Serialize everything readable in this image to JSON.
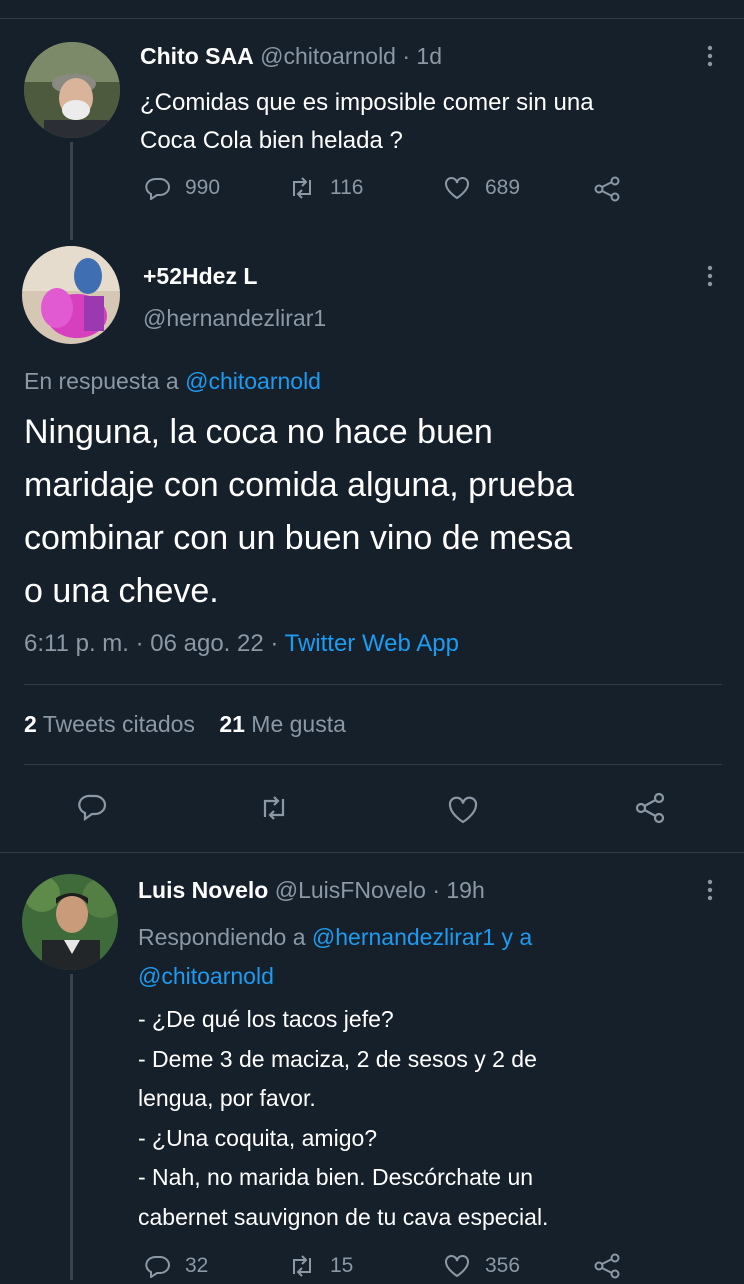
{
  "tweet1": {
    "name": "Chito SAA",
    "handle": "@chitoarnold",
    "time": "· 1d",
    "text_line1": "¿Comidas que es imposible comer sin una",
    "text_line2": "Coca Cola bien helada ?",
    "replies": "990",
    "retweets": "116",
    "likes": "689"
  },
  "tweet2": {
    "name": "+52Hdez L",
    "handle": "@hernandezlirar1",
    "reply_prefix": "En respuesta a ",
    "reply_to": "@chitoarnold",
    "text_lines": [
      "Ninguna, la coca no hace buen",
      "maridaje con comida alguna, prueba",
      "combinar con un buen vino de mesa",
      "o una cheve."
    ],
    "time": "6:11 p. m. · 06 ago. 22 · ",
    "source": "Twitter Web App",
    "quotes_count": "2",
    "quotes_label": "Tweets citados",
    "likes_count": "21",
    "likes_label": "Me gusta"
  },
  "tweet3": {
    "name": "Luis Novelo",
    "handle": "@LuisFNovelo",
    "time": "· 19h",
    "reply_prefix": "Respondiendo a ",
    "reply_to1": "@hernandezlirar1",
    "reply_and": " y a",
    "reply_to2": "@chitoarnold",
    "text_lines": [
      "- ¿De qué los tacos jefe?",
      "- Deme 3 de maciza, 2 de sesos y 2 de",
      "lengua, por favor.",
      "- ¿Una coquita, amigo?",
      "- Nah, no marida bien. Descórchate un",
      "cabernet sauvignon de tu cava especial."
    ],
    "replies": "32",
    "retweets": "15",
    "likes": "356"
  },
  "icons": {
    "reply": "reply-icon",
    "retweet": "retweet-icon",
    "like": "heart-icon",
    "share": "share-icon",
    "more": "more-icon"
  },
  "colors": {
    "background": "#15202b",
    "link": "#1d9bf0",
    "muted": "#8b98a5",
    "divider": "#2f3b47"
  }
}
